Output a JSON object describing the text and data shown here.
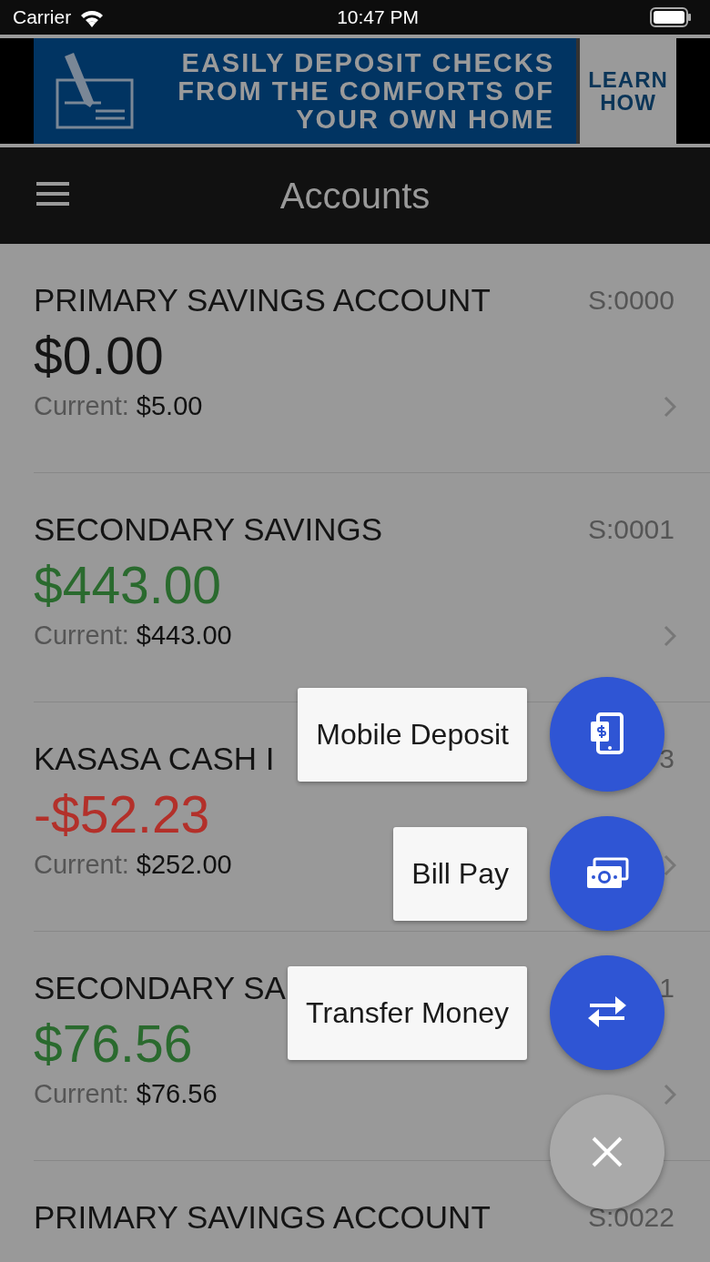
{
  "status_bar": {
    "carrier": "Carrier",
    "time": "10:47 PM"
  },
  "banner": {
    "headline": [
      "EASILY DEPOSIT CHECKS",
      "FROM THE COMFORTS OF",
      "YOUR OWN HOME"
    ],
    "button": "LEARN HOW"
  },
  "header": {
    "title": "Accounts"
  },
  "accounts": [
    {
      "name": "PRIMARY SAVINGS ACCOUNT",
      "code": "S:0000",
      "balance": "$0.00",
      "color": "#141414",
      "current_label": "Current:",
      "current": "$5.00"
    },
    {
      "name": "SECONDARY SAVINGS",
      "code": "S:0001",
      "balance": "$443.00",
      "color": "#2a6a2e",
      "current_label": "Current:",
      "current": "$443.00"
    },
    {
      "name": "KASASA CASH I",
      "code": "3",
      "balance": "-$52.23",
      "color": "#b3302a",
      "current_label": "Current:",
      "current": "$252.00"
    },
    {
      "name": "SECONDARY SA",
      "code": "1",
      "balance": "$76.56",
      "color": "#2a6a2e",
      "current_label": "Current:",
      "current": "$76.56"
    },
    {
      "name": "PRIMARY SAVINGS ACCOUNT",
      "code": "S:0022"
    }
  ],
  "fab_menu": {
    "actions": [
      {
        "label": "Mobile Deposit",
        "kind": "deposit"
      },
      {
        "label": "Bill Pay",
        "kind": "bills"
      },
      {
        "label": "Transfer Money",
        "kind": "transfer"
      }
    ]
  }
}
